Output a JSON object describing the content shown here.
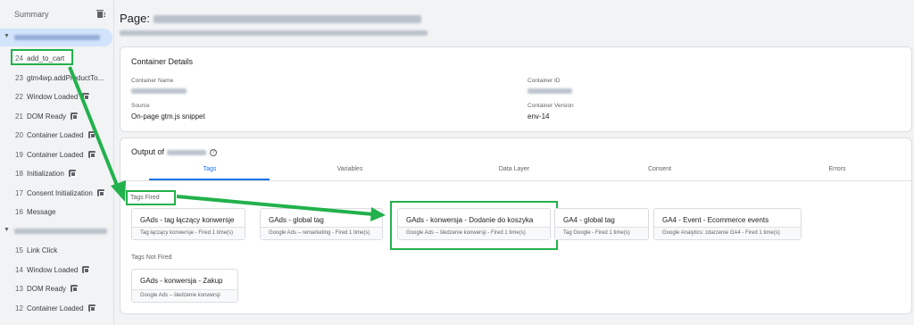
{
  "sidebar": {
    "summary_label": "Summary",
    "events_top": [
      {
        "num": "24",
        "label": "add_to_cart",
        "icon": false
      },
      {
        "num": "23",
        "label": "gtm4wp.addProductTo...",
        "icon": false
      },
      {
        "num": "22",
        "label": "Window Loaded",
        "icon": true
      },
      {
        "num": "21",
        "label": "DOM Ready",
        "icon": true
      },
      {
        "num": "20",
        "label": "Container Loaded",
        "icon": true
      },
      {
        "num": "19",
        "label": "Container Loaded",
        "icon": true
      },
      {
        "num": "18",
        "label": "Initialization",
        "icon": true
      },
      {
        "num": "17",
        "label": "Consent Initialization",
        "icon": true
      },
      {
        "num": "16",
        "label": "Message",
        "icon": false
      }
    ],
    "events_bottom": [
      {
        "num": "15",
        "label": "Link Click",
        "icon": false
      },
      {
        "num": "14",
        "label": "Window Loaded",
        "icon": true
      },
      {
        "num": "13",
        "label": "DOM Ready",
        "icon": true
      },
      {
        "num": "12",
        "label": "Container Loaded",
        "icon": true
      }
    ]
  },
  "page": {
    "title_prefix": "Page:"
  },
  "container_details": {
    "title": "Container Details",
    "name_label": "Container Name",
    "id_label": "Container ID",
    "source_label": "Source",
    "source_value": "On-page gtm.js snippet",
    "version_label": "Container Version",
    "version_value": "env-14"
  },
  "output": {
    "title_prefix": "Output of",
    "tabs": [
      "Tags",
      "Variables",
      "Data Layer",
      "Consent",
      "Errors"
    ],
    "active_tab": "Tags",
    "fired_label": "Tags Fired",
    "not_fired_label": "Tags Not Fired",
    "tags_fired": [
      {
        "name": "GAds - tag łączący konwersje",
        "sub": "Tag łączący konwersje - Fired 1 time(s)"
      },
      {
        "name": "GAds - global tag",
        "sub": "Google Ads – remarketing - Fired 1 time(s)"
      },
      {
        "name": "GAds - konwersja - Dodanie do koszyka",
        "sub": "Google Ads – śledzenie konwersji - Fired 1 time(s)"
      },
      {
        "name": "GA4 - global tag",
        "sub": "Tag Google - Fired 1 time(s)"
      },
      {
        "name": "GA4 - Event - Ecommerce events",
        "sub": "Google Analytics: zdarzenie GA4 - Fired 1 time(s)"
      }
    ],
    "tags_not_fired": [
      {
        "name": "GAds - konwersja - Zakup",
        "sub": "Google Ads – śledzenie konwersji"
      }
    ]
  },
  "colors": {
    "highlight": "#22b14c",
    "accent": "#1a73e8"
  }
}
